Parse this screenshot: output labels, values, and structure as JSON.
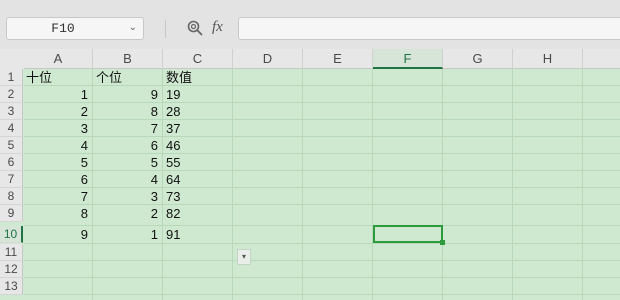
{
  "formula_bar": {
    "name_box": "F10",
    "name_box_dropdown": "⌄",
    "fx_label": "fx",
    "formula_value": ""
  },
  "columns": [
    "A",
    "B",
    "C",
    "D",
    "E",
    "F",
    "G",
    "H",
    ""
  ],
  "active_column": "F",
  "rows": [
    "1",
    "2",
    "3",
    "4",
    "5",
    "6",
    "7",
    "8",
    "9",
    "10",
    "11",
    "12",
    "13"
  ],
  "active_row": "10",
  "cells": {
    "A1": "十位",
    "B1": "个位",
    "C1": "数值",
    "A2": "1",
    "B2": "9",
    "C2": "19",
    "A3": "2",
    "B3": "8",
    "C3": "28",
    "A4": "3",
    "B4": "7",
    "C4": "37",
    "A5": "4",
    "B5": "6",
    "C5": "46",
    "A6": "5",
    "B6": "5",
    "C6": "55",
    "A7": "6",
    "B7": "4",
    "C7": "64",
    "A8": "7",
    "B8": "3",
    "C8": "73",
    "A9": "8",
    "B9": "2",
    "C9": "82",
    "A10": "9",
    "B10": "1",
    "C10": "91"
  },
  "paste_options_icon": "▾",
  "colors": {
    "sheet_background": "#cfe8d0",
    "active_accent": "#217346",
    "selection_border": "#2e9a3e"
  }
}
